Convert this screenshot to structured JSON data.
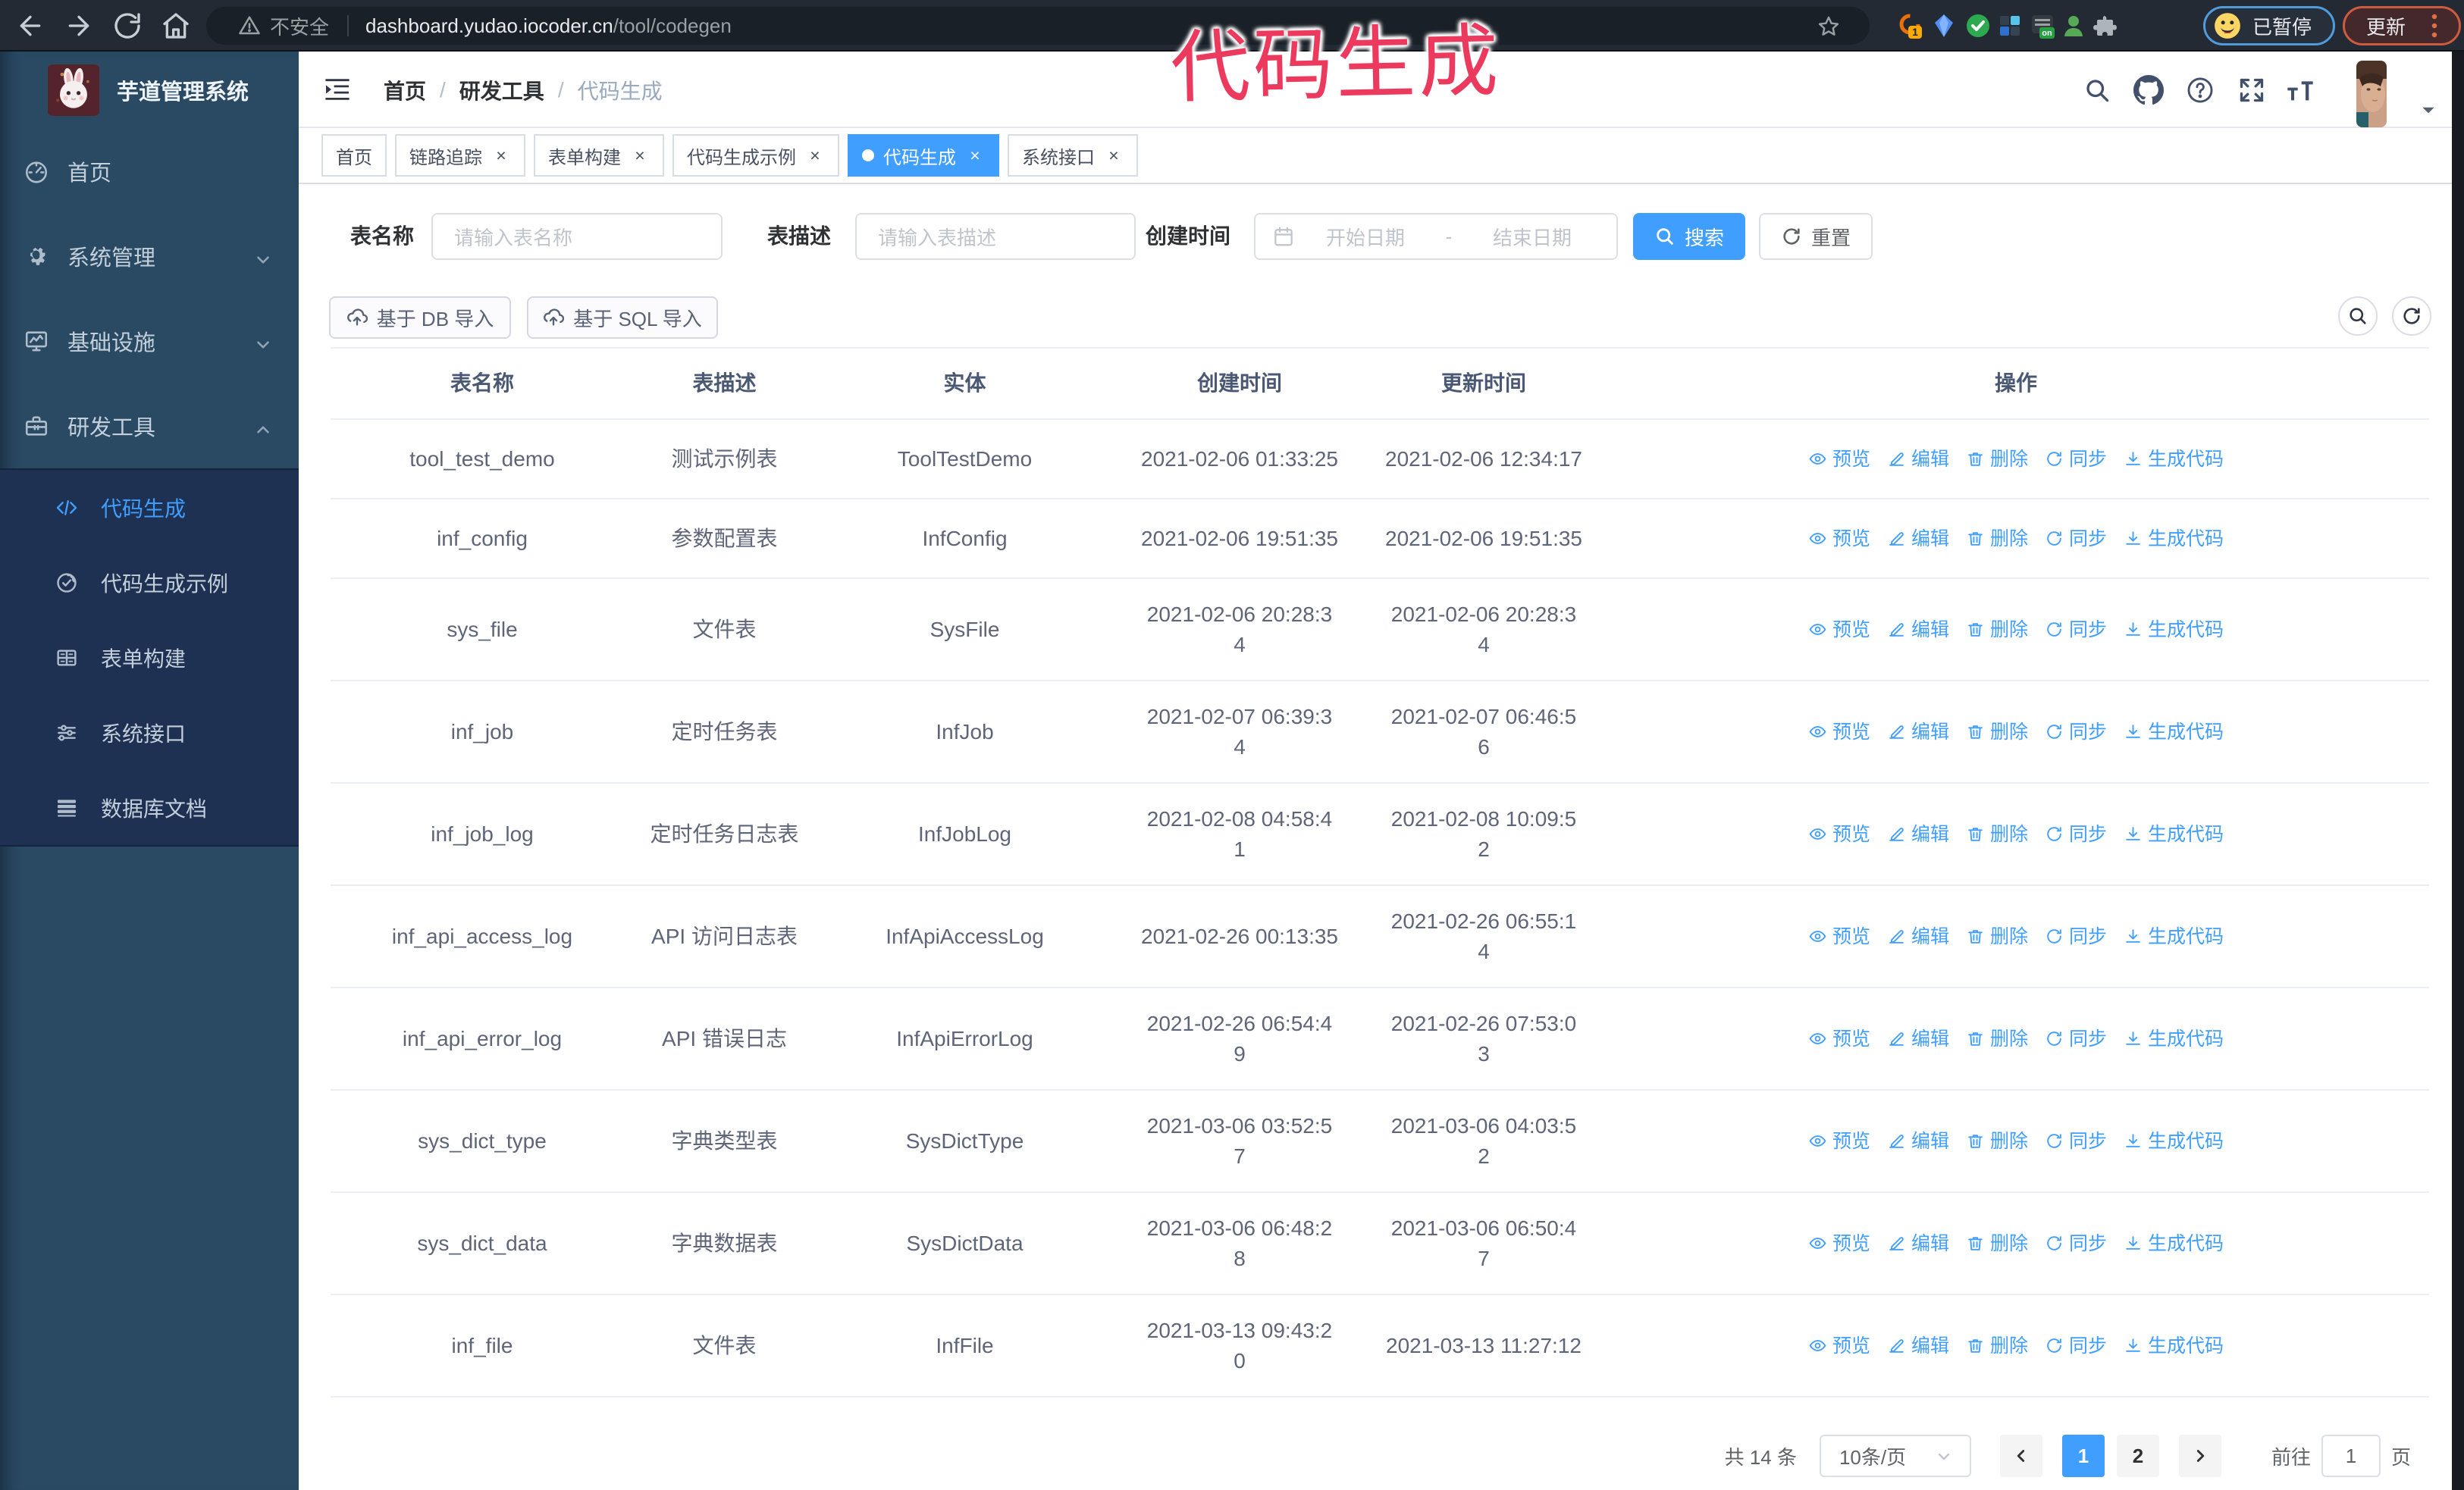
{
  "colors": {
    "accent": "#409eff",
    "sidebar_bg": "#2a4d6b",
    "submenu_bg": "#1e3152",
    "annotation": "#ee3b64",
    "chrome_bg": "#232a33"
  },
  "browser": {
    "security_label": "不安全",
    "url_host": "dashboard.yudao.iocoder.cn",
    "url_path": "/tool/codegen",
    "extension_badge": "1",
    "extension_on_badge": "on",
    "paused_label": "已暂停",
    "update_label": "更新"
  },
  "annotation": {
    "text": "代码生成"
  },
  "sidebar": {
    "title": "芋道管理系统",
    "menu": [
      {
        "label": "首页",
        "icon": "dashboard"
      },
      {
        "label": "系统管理",
        "icon": "gear",
        "chevron": "down"
      },
      {
        "label": "基础设施",
        "icon": "monitor",
        "chevron": "down"
      },
      {
        "label": "研发工具",
        "icon": "toolbox",
        "chevron": "up",
        "mod": "expanded"
      }
    ],
    "submenu": [
      {
        "label": "代码生成",
        "icon": "code",
        "mod": "active"
      },
      {
        "label": "代码生成示例",
        "icon": "badge-check"
      },
      {
        "label": "表单构建",
        "icon": "form-grid"
      },
      {
        "label": "系统接口",
        "icon": "sliders"
      },
      {
        "label": "数据库文档",
        "icon": "table-rows"
      }
    ]
  },
  "header": {
    "breadcrumb": [
      {
        "label": "首页"
      },
      {
        "label": "研发工具",
        "sep": "/"
      },
      {
        "label": "代码生成",
        "sep": "/",
        "mod": "current"
      }
    ]
  },
  "tags": [
    {
      "label": "首页"
    },
    {
      "label": "链路追踪",
      "closable": true
    },
    {
      "label": "表单构建",
      "closable": true
    },
    {
      "label": "代码生成示例",
      "closable": true
    },
    {
      "label": "代码生成",
      "closable": true,
      "active": true,
      "mod": "active"
    },
    {
      "label": "系统接口",
      "closable": true
    }
  ],
  "filters": {
    "name_label": "表名称",
    "name_placeholder": "请输入表名称",
    "desc_label": "表描述",
    "desc_placeholder": "请输入表描述",
    "time_label": "创建时间",
    "start_placeholder": "开始日期",
    "range_separator": "-",
    "end_placeholder": "结束日期",
    "search_label": "搜索",
    "reset_label": "重置"
  },
  "toolbar": {
    "import_db_label": "基于 DB 导入",
    "import_sql_label": "基于 SQL 导入"
  },
  "table": {
    "columns": [
      "表名称",
      "表描述",
      "实体",
      "创建时间",
      "更新时间",
      "操作"
    ],
    "actions": [
      {
        "label": "预览",
        "icon": "eye"
      },
      {
        "label": "编辑",
        "icon": "edit"
      },
      {
        "label": "删除",
        "icon": "trash"
      },
      {
        "label": "同步",
        "icon": "sync"
      },
      {
        "label": "生成代码",
        "icon": "download"
      }
    ],
    "rows": [
      {
        "name": "tool_test_demo",
        "desc": "测试示例表",
        "entity": "ToolTestDemo",
        "created": "2021-02-06 01:33:25",
        "updated": "2021-02-06 12:34:17"
      },
      {
        "name": "inf_config",
        "desc": "参数配置表",
        "entity": "InfConfig",
        "created": "2021-02-06 19:51:35",
        "updated": "2021-02-06 19:51:35"
      },
      {
        "name": "sys_file",
        "desc": "文件表",
        "entity": "SysFile",
        "created": "2021-02-06 20:28:3\n4",
        "updated": "2021-02-06 20:28:3\n4"
      },
      {
        "name": "inf_job",
        "desc": "定时任务表",
        "entity": "InfJob",
        "created": "2021-02-07 06:39:3\n4",
        "updated": "2021-02-07 06:46:5\n6"
      },
      {
        "name": "inf_job_log",
        "desc": "定时任务日志表",
        "entity": "InfJobLog",
        "created": "2021-02-08 04:58:4\n1",
        "updated": "2021-02-08 10:09:5\n2"
      },
      {
        "name": "inf_api_access_log",
        "desc": "API 访问日志表",
        "entity": "InfApiAccessLog",
        "created": "2021-02-26 00:13:35",
        "updated": "2021-02-26 06:55:1\n4"
      },
      {
        "name": "inf_api_error_log",
        "desc": "API 错误日志",
        "entity": "InfApiErrorLog",
        "created": "2021-02-26 06:54:4\n9",
        "updated": "2021-02-26 07:53:0\n3"
      },
      {
        "name": "sys_dict_type",
        "desc": "字典类型表",
        "entity": "SysDictType",
        "created": "2021-03-06 03:52:5\n7",
        "updated": "2021-03-06 04:03:5\n2"
      },
      {
        "name": "sys_dict_data",
        "desc": "字典数据表",
        "entity": "SysDictData",
        "created": "2021-03-06 06:48:2\n8",
        "updated": "2021-03-06 06:50:4\n7"
      },
      {
        "name": "inf_file",
        "desc": "文件表",
        "entity": "InfFile",
        "created": "2021-03-13 09:43:2\n0",
        "updated": "2021-03-13 11:27:12"
      }
    ]
  },
  "pagination": {
    "total_label": "共 14 条",
    "page_size_label": "10条/页",
    "pages": [
      {
        "label": "1",
        "mod": "active"
      },
      {
        "label": "2"
      }
    ],
    "goto_label": "前往",
    "goto_value": "1",
    "page_unit_label": "页"
  }
}
